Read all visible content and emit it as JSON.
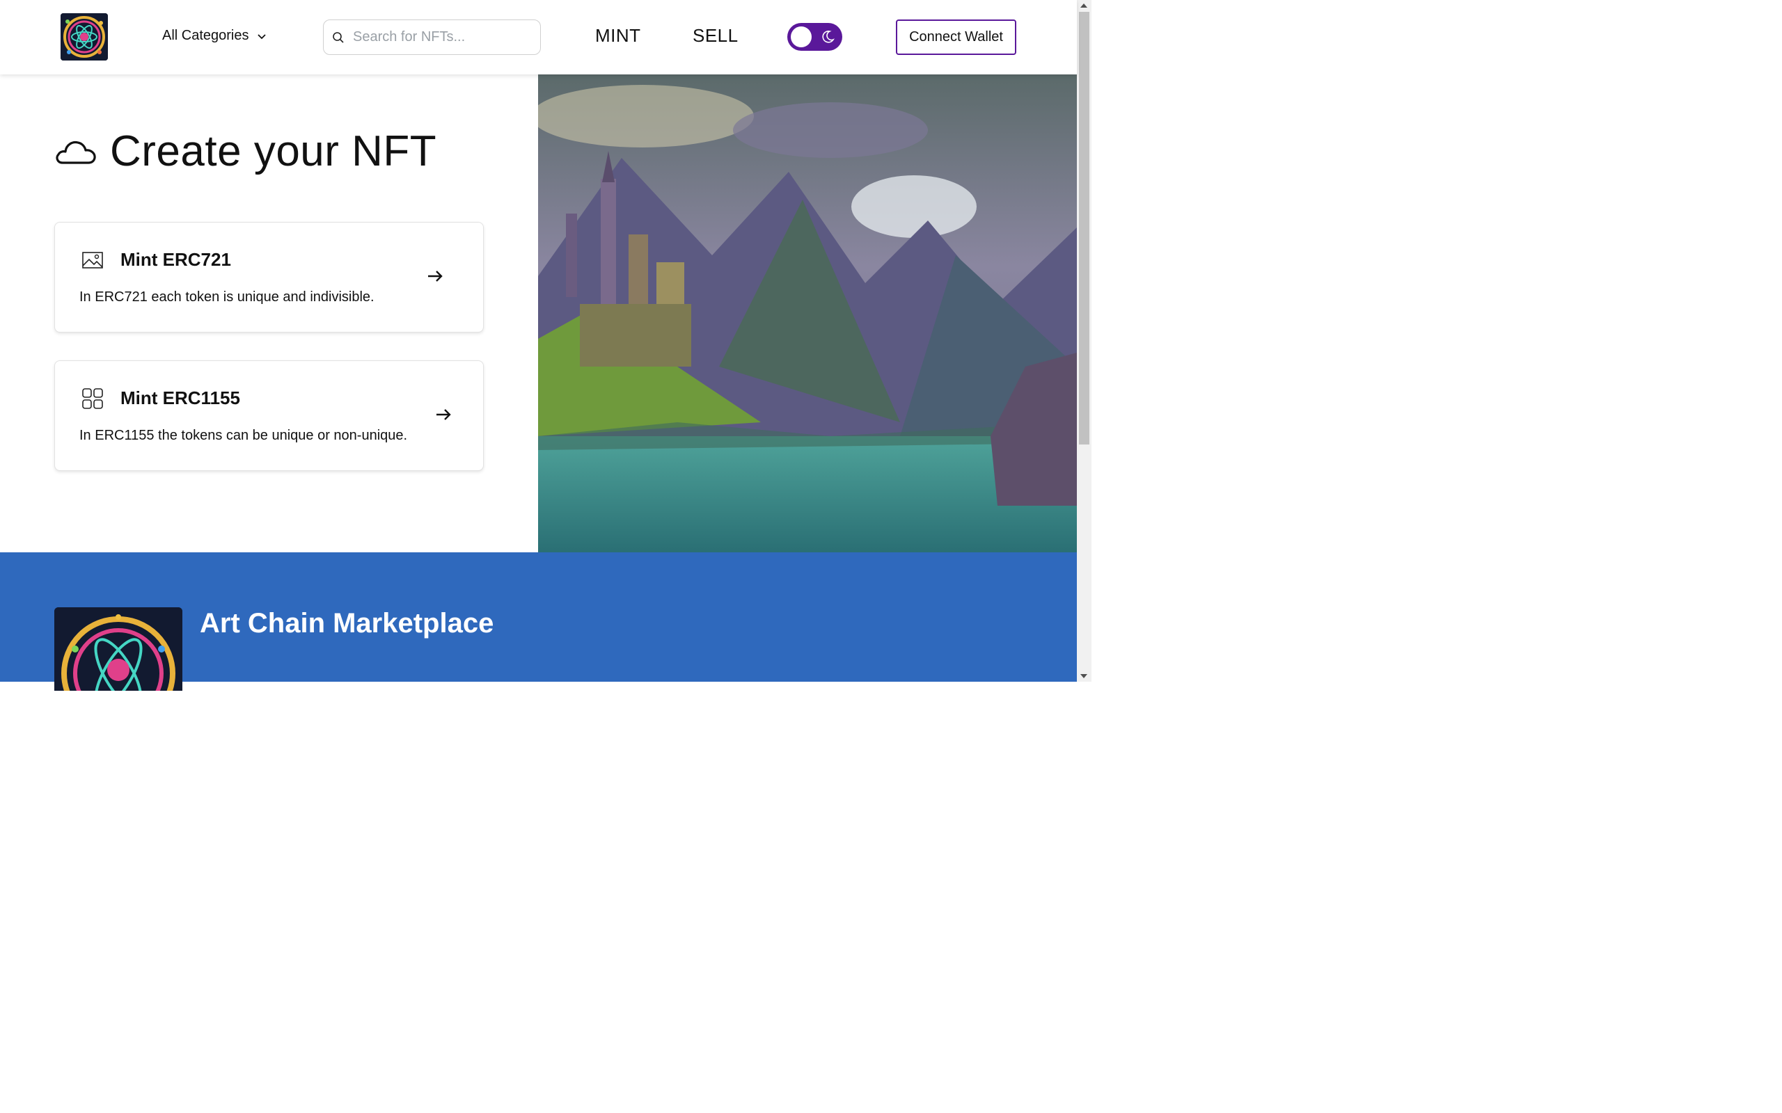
{
  "header": {
    "logo_icon": "nft-atom-logo-icon",
    "category_label": "All Categories",
    "search_placeholder": "Search for NFTs...",
    "nav": [
      "MINT",
      "SELL"
    ],
    "theme_toggle": {
      "mode": "dark",
      "icon": "moon-icon"
    },
    "wallet_label": "Connect Wallet",
    "accent_color": "#5a189a"
  },
  "main": {
    "title_icon": "cloud-icon",
    "title": "Create your NFT",
    "cards": [
      {
        "icon": "image-icon",
        "title": "Mint ERC721",
        "description": "In ERC721 each token is unique and indivisible."
      },
      {
        "icon": "grid-icon",
        "title": "Mint ERC1155",
        "description": "In ERC1155 the tokens can be unique or non-unique."
      }
    ],
    "hero_image": "fantasy-castle-lake-painting"
  },
  "footer": {
    "logo_icon": "nft-atom-logo-icon",
    "title": "Art Chain Marketplace",
    "background_color": "#2f69bd"
  }
}
